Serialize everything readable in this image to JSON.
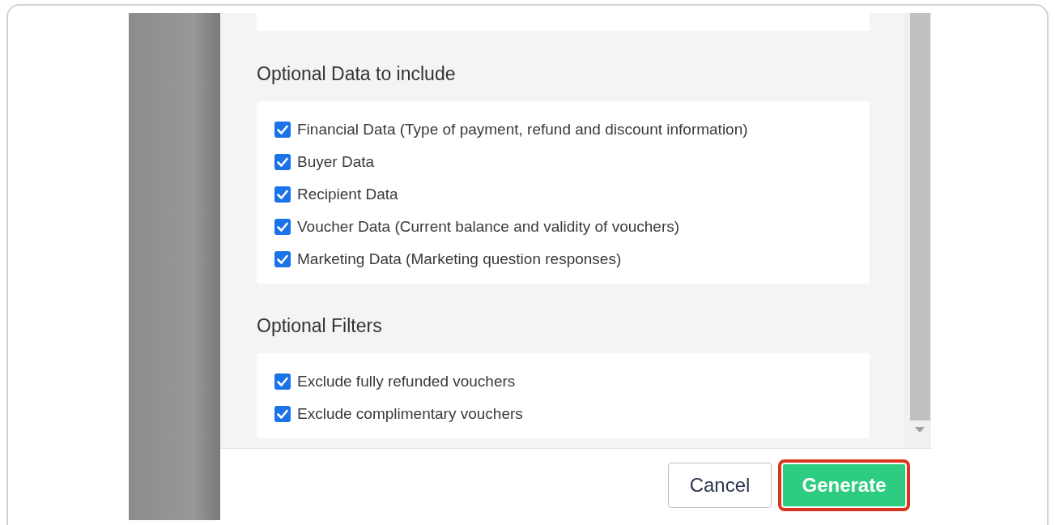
{
  "sections": [
    {
      "title": "Optional Data to include",
      "options": [
        {
          "label": "Financial Data (Type of payment, refund and discount information)",
          "checked": true
        },
        {
          "label": "Buyer Data",
          "checked": true
        },
        {
          "label": "Recipient Data",
          "checked": true
        },
        {
          "label": "Voucher Data (Current balance and validity of vouchers)",
          "checked": true
        },
        {
          "label": "Marketing Data (Marketing question responses)",
          "checked": true
        }
      ]
    },
    {
      "title": "Optional Filters",
      "options": [
        {
          "label": "Exclude fully refunded vouchers",
          "checked": true
        },
        {
          "label": "Exclude complimentary vouchers",
          "checked": true
        }
      ]
    }
  ],
  "buttons": [
    {
      "label": "Cancel",
      "kind": "secondary",
      "highlighted": false
    },
    {
      "label": "Generate",
      "kind": "primary",
      "highlighted": true
    }
  ]
}
